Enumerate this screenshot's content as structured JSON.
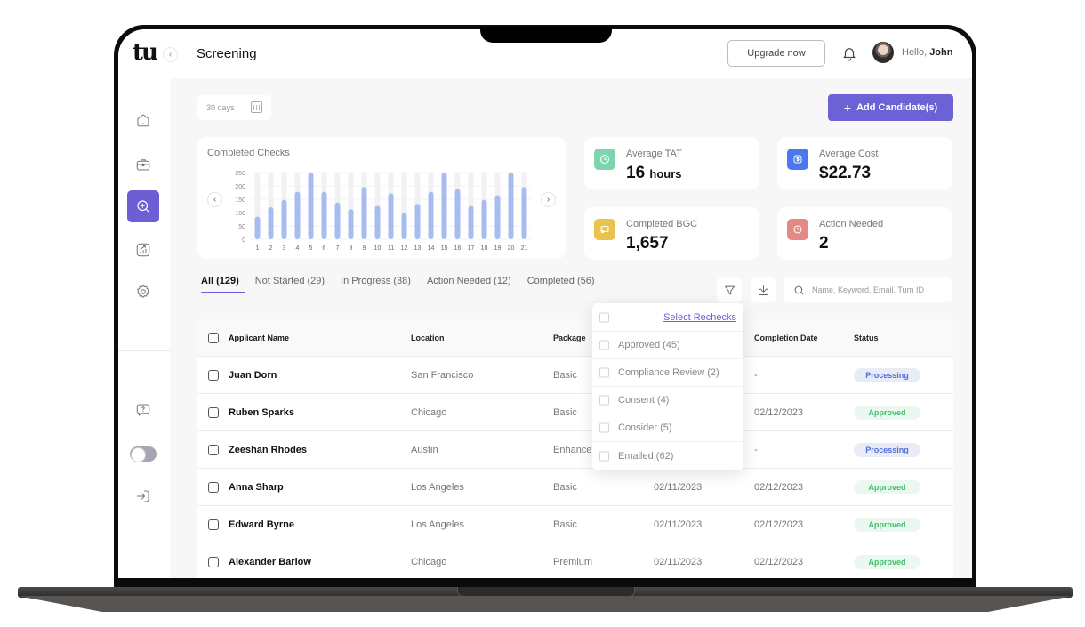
{
  "app": {
    "logo": "tu",
    "page_title": "Screening",
    "upgrade_label": "Upgrade now",
    "greeting_prefix": "Hello, ",
    "greeting_name": "John"
  },
  "sidebar": {
    "items": [
      {
        "name": "home",
        "icon": "home-icon",
        "active": false
      },
      {
        "name": "jobs",
        "icon": "briefcase-icon",
        "active": false
      },
      {
        "name": "screening",
        "icon": "search-plus-icon",
        "active": true
      },
      {
        "name": "reports",
        "icon": "chart-icon",
        "active": false
      },
      {
        "name": "settings",
        "icon": "gear-icon",
        "active": false
      }
    ],
    "bottom": [
      {
        "name": "help",
        "icon": "help-bubble-icon"
      },
      {
        "name": "theme-toggle",
        "icon": "toggle",
        "state": "off"
      },
      {
        "name": "logout",
        "icon": "sign-in-icon"
      }
    ]
  },
  "toolbar": {
    "range_label": "30 days",
    "add_label": "Add Candidate(s)",
    "search_placeholder": "Name, Keyword, Email, Turn ID"
  },
  "colors": {
    "accent": "#6c61d5",
    "bar": "#a7bdf0",
    "bar_track": "#f1f1f3",
    "tat_icon": "#7fd4b0",
    "cost_icon": "#4a76ee",
    "bgc_icon": "#e8c44e",
    "action_icon": "#e38a86",
    "processing": "#4f6ee0",
    "approved": "#3fbf6b"
  },
  "chart_data": {
    "type": "bar",
    "title": "Completed Checks",
    "categories": [
      "1",
      "2",
      "3",
      "4",
      "5",
      "6",
      "7",
      "8",
      "9",
      "10",
      "11",
      "12",
      "13",
      "14",
      "15",
      "16",
      "17",
      "18",
      "19",
      "20",
      "21"
    ],
    "values": [
      85,
      120,
      148,
      178,
      250,
      178,
      138,
      113,
      196,
      125,
      172,
      98,
      133,
      178,
      250,
      188,
      125,
      148,
      165,
      250,
      196
    ],
    "yticks": [
      "0",
      "50",
      "100",
      "150",
      "200",
      "250"
    ],
    "ylim": [
      0,
      250
    ],
    "xlabel": "",
    "ylabel": "",
    "grid": true,
    "legend": "none"
  },
  "stats": [
    {
      "label": "Average TAT",
      "value": "16",
      "unit": "hours",
      "icon": "clock-icon"
    },
    {
      "label": "Average Cost",
      "value": "$22.73",
      "unit": "",
      "icon": "dollar-icon"
    },
    {
      "label": "Completed BGC",
      "value": "1,657",
      "unit": "",
      "icon": "badge-check-icon"
    },
    {
      "label": "Action Needed",
      "value": "2",
      "unit": "",
      "icon": "alert-icon"
    }
  ],
  "tabs": [
    {
      "label": "All (129)",
      "active": true
    },
    {
      "label": "Not Started (29)",
      "active": false
    },
    {
      "label": "In Progress (38)",
      "active": false
    },
    {
      "label": "Action Needed (12)",
      "active": false
    },
    {
      "label": "Completed (56)",
      "active": false
    }
  ],
  "table": {
    "headers": [
      "Applicant Name",
      "Location",
      "Package",
      "",
      "Completion Date",
      "Status"
    ],
    "rows": [
      {
        "name": "Juan Dorn",
        "location": "San Francisco",
        "package": "Basic",
        "request_date": "",
        "completion_date": "-",
        "status": "Processing"
      },
      {
        "name": "Ruben Sparks",
        "location": "Chicago",
        "package": "Basic",
        "request_date": "",
        "completion_date": "02/12/2023",
        "status": "Approved"
      },
      {
        "name": "Zeeshan Rhodes",
        "location": "Austin",
        "package": "Enhance",
        "request_date": "",
        "completion_date": "-",
        "status": "Processing"
      },
      {
        "name": "Anna Sharp",
        "location": "Los Angeles",
        "package": "Basic",
        "request_date": "02/11/2023",
        "completion_date": "02/12/2023",
        "status": "Approved"
      },
      {
        "name": "Edward Byrne",
        "location": "Los Angeles",
        "package": "Basic",
        "request_date": "02/11/2023",
        "completion_date": "02/12/2023",
        "status": "Approved"
      },
      {
        "name": "Alexander Barlow",
        "location": "Chicago",
        "package": "Premium",
        "request_date": "02/11/2023",
        "completion_date": "02/12/2023",
        "status": "Approved"
      }
    ]
  },
  "filter_dropdown": {
    "link_label": "Select Rechecks",
    "options": [
      {
        "label": "Approved (45)",
        "checked": false
      },
      {
        "label": "Compliance Review (2)",
        "checked": false
      },
      {
        "label": "Consent (4)",
        "checked": false
      },
      {
        "label": "Consider (5)",
        "checked": false
      },
      {
        "label": "Emailed (62)",
        "checked": false
      }
    ]
  }
}
